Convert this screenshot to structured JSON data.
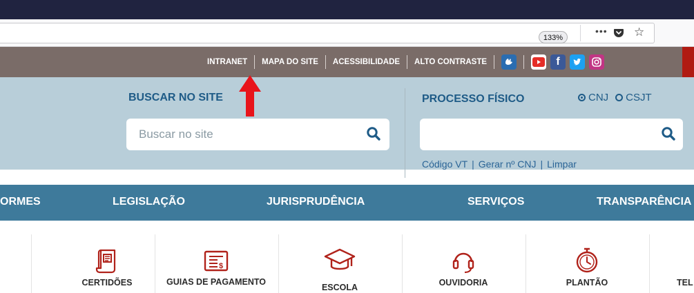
{
  "browser": {
    "zoom": "133%",
    "menu_icon": "ellipsis-icon",
    "pocket_icon": "pocket-icon",
    "bookmark_icon": "star-icon"
  },
  "topbar": {
    "links": [
      "INTRANET",
      "MAPA DO SITE",
      "ACESSIBILIDADE",
      "ALTO CONTRASTE"
    ],
    "social": [
      "libras-icon",
      "youtube-icon",
      "facebook-icon",
      "twitter-icon",
      "instagram-icon"
    ]
  },
  "search": {
    "label": "BUSCAR NO SITE",
    "placeholder": "Buscar no site"
  },
  "processo": {
    "label": "PROCESSO FÍSICO",
    "radio_cnj": "CNJ",
    "radio_csjt": "CSJT",
    "value": "",
    "link_codigo": "Código VT",
    "link_gerar": "Gerar nº CNJ",
    "link_limpar": "Limpar"
  },
  "nav": {
    "items": [
      "ORMES",
      "LEGISLAÇÃO",
      "JURISPRUDÊNCIA",
      "SERVIÇOS",
      "TRANSPARÊNCIA"
    ]
  },
  "services": {
    "items": [
      {
        "label": "CERTIDÕES",
        "icon": "scroll-icon"
      },
      {
        "label": "GUIAS DE PAGAMENTO",
        "icon": "invoice-icon"
      },
      {
        "label": "ESCOLA",
        "icon": "graduation-cap-icon"
      },
      {
        "label": "OUVIDORIA",
        "icon": "headset-icon"
      },
      {
        "label": "PLANTÃO",
        "icon": "stopwatch-icon"
      },
      {
        "label": "TEL",
        "icon": "phone-icon"
      }
    ]
  },
  "colors": {
    "topbar": "#7a6c68",
    "search_bg": "#b8ced9",
    "nav_bg": "#3e7a9b",
    "accent": "#1e5b87",
    "icon_red": "#b0221a",
    "annotation_arrow": "#e8141b"
  }
}
